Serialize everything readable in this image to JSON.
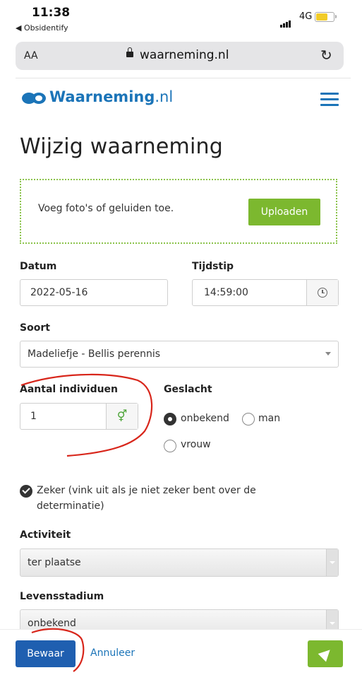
{
  "status_bar": {
    "time": "11:38",
    "back_app": "◀ Obsidentify",
    "network": "4G",
    "battery_level": 0.65
  },
  "browser": {
    "text_size_label": "AA",
    "url": "waarneming.nl",
    "reload_icon": "reload-icon"
  },
  "site": {
    "logo_bold": "Waarneming",
    "logo_light": ".nl",
    "menu_icon": "hamburger-menu-icon",
    "brand_color": "#1b74b8"
  },
  "page": {
    "title": "Wijzig waarneming"
  },
  "upload": {
    "text": "Voeg foto's of geluiden toe.",
    "button_label": "Uploaden",
    "color": "#7cb82f"
  },
  "form": {
    "date_label": "Datum",
    "date_value": "2022-05-16",
    "time_label": "Tijdstip",
    "time_value": "14:59:00",
    "species_label": "Soort",
    "species_value": "Madeliefje - Bellis perennis",
    "count_label": "Aantal individuen",
    "count_value": "1",
    "gender_icon": "⚥",
    "sex_label": "Geslacht",
    "sex_options": [
      "onbekend",
      "man",
      "vrouw"
    ],
    "sex_selected": "onbekend",
    "certain_label": "Zeker (vink uit als je niet zeker bent over de determinatie)",
    "certain_checked": true,
    "activity_label": "Activiteit",
    "activity_value": "ter plaatse",
    "life_stage_label": "Levensstadium",
    "life_stage_value": "onbekend"
  },
  "actions": {
    "save_label": "Bewaar",
    "cancel_label": "Annuleer",
    "send_icon": "paper-plane-icon",
    "save_color": "#1f5fb0"
  }
}
